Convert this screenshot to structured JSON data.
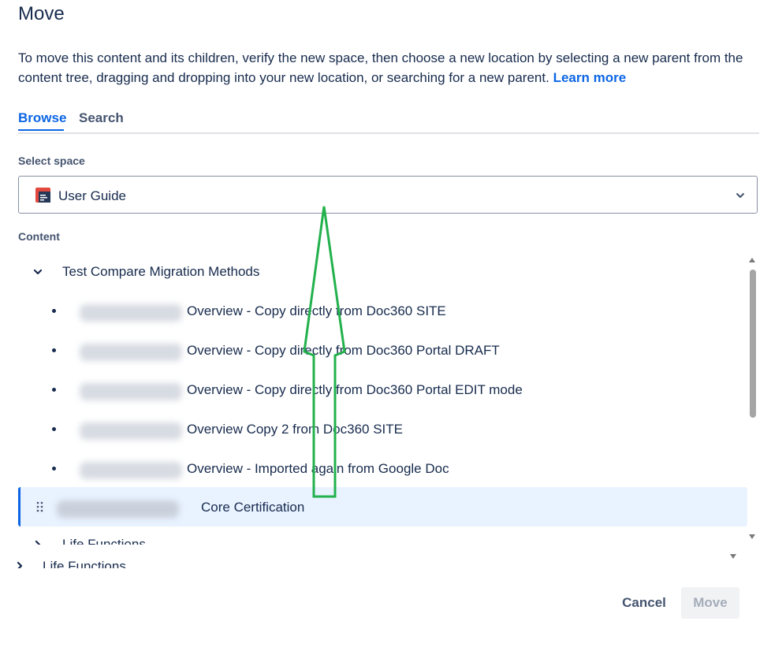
{
  "dialog": {
    "title": "Move",
    "description": "To move this content and its children, verify the new space, then choose a new location by selecting a new parent from the content tree, dragging and dropping into your new location, or searching for a new parent.",
    "learn_more": "Learn more"
  },
  "tabs": [
    {
      "label": "Browse",
      "active": true
    },
    {
      "label": "Search",
      "active": false
    }
  ],
  "space": {
    "label": "Select space",
    "value": "User Guide",
    "icon": "space-document-icon"
  },
  "content": {
    "label": "Content",
    "parent": "Test Compare Migration Methods",
    "children": [
      {
        "title": "Overview - Copy directly from Doc360 SITE"
      },
      {
        "title": "Overview - Copy directly from Doc360 Portal DRAFT"
      },
      {
        "title": "Overview - Copy directly from Doc360 Portal EDIT mode"
      },
      {
        "title": "Overview Copy 2 from Doc360 SITE"
      },
      {
        "title": "Overview - Imported again from Google Doc"
      }
    ],
    "selected": "Core Certification",
    "partial_row_1": "Life Functions",
    "partial_row_2": "Life Functions"
  },
  "actions": {
    "cancel": "Cancel",
    "move": "Move"
  },
  "colors": {
    "accent": "#0c66e4",
    "selected_bg": "#e9f2ff",
    "annotation_arrow": "#22b14c"
  }
}
